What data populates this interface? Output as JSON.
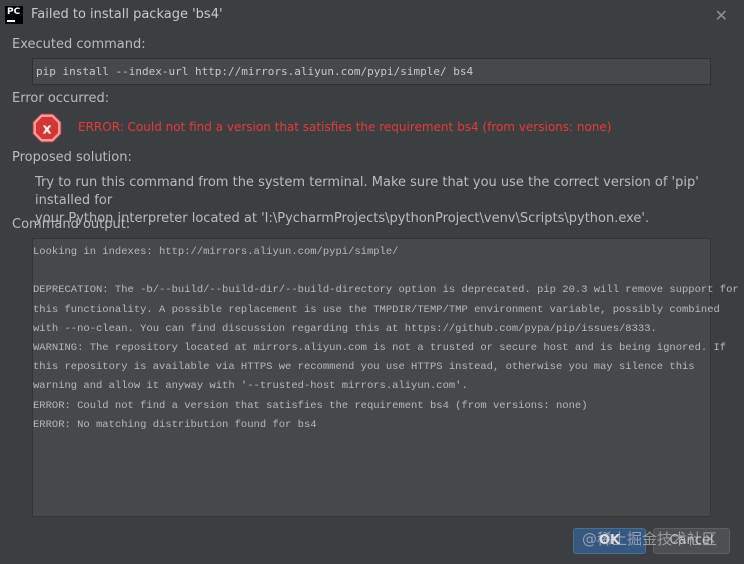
{
  "window": {
    "app_icon_text": "PC",
    "title": "Failed to install package 'bs4'"
  },
  "executed": {
    "label": "Executed command:",
    "command": "pip install --index-url http://mirrors.aliyun.com/pypi/simple/ bs4"
  },
  "error": {
    "label": "Error occurred:",
    "message": "ERROR: Could not find a version that satisfies the requirement bs4 (from versions: none)",
    "icon_color": "#e53a3a"
  },
  "solution": {
    "label": "Proposed solution:",
    "line1": "Try to run this command from the system terminal. Make sure that you use the correct version of 'pip' installed for",
    "line2": "your Python interpreter located at 'I:\\PycharmProjects\\pythonProject\\venv\\Scripts\\python.exe'."
  },
  "output": {
    "label": "Command output:",
    "lines": [
      "Looking in indexes: http://mirrors.aliyun.com/pypi/simple/",
      "",
      "DEPRECATION: The -b/--build/--build-dir/--build-directory option is deprecated. pip 20.3 will remove support for",
      "this functionality. A possible replacement is use the TMPDIR/TEMP/TMP environment variable, possibly combined",
      "with --no-clean. You can find discussion regarding this at https://github.com/pypa/pip/issues/8333.",
      "WARNING: The repository located at mirrors.aliyun.com is not a trusted or secure host and is being ignored. If",
      "this repository is available via HTTPS we recommend you use HTTPS instead, otherwise you may silence this",
      "warning and allow it anyway with '--trusted-host mirrors.aliyun.com'.",
      "ERROR: Could not find a version that satisfies the requirement bs4 (from versions: none)",
      "ERROR: No matching distribution found for bs4"
    ]
  },
  "buttons": {
    "ok": "OK",
    "cancel": "Cancel"
  },
  "watermark": "@稀土掘金技术社区",
  "colors": {
    "background": "#3c3f41",
    "field": "#45494a",
    "ok_button": "#365880"
  }
}
